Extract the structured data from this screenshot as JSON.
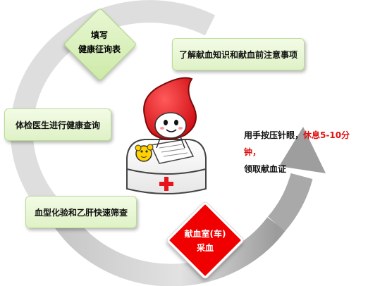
{
  "steps": {
    "fill_form": {
      "line1": "填写",
      "line2": "健康征询表"
    },
    "learn": {
      "label": "了解献血知识和献血前注意事项"
    },
    "checkup": {
      "label": "体检医生进行健康查询"
    },
    "screening": {
      "label": "血型化验和乙肝快速筛查"
    },
    "collection": {
      "line1": "献血室(车)",
      "line2": "采血"
    }
  },
  "aftercare": {
    "part1": "用手按压针眼，",
    "highlight": "休息5-10分钟，",
    "line2": "领取献血证"
  },
  "colors": {
    "box_fill": "#dff2c6",
    "box_border": "#b9dd95",
    "arrow_gray": "#b8b8b8",
    "blood_red": "#e8141b",
    "highlight_red": "#e01010"
  },
  "icons": {
    "mascot": "blood-drop-mascot-icon",
    "kit": "medical-kit-icon"
  }
}
